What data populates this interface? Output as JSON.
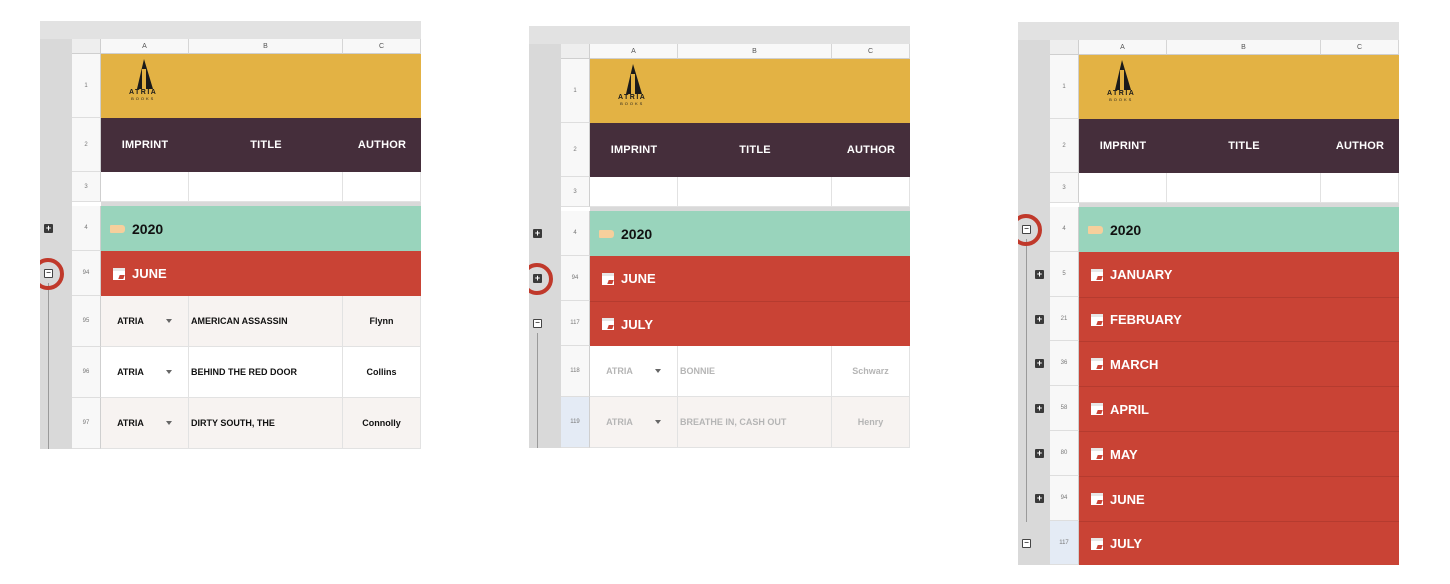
{
  "columns": [
    "A",
    "B",
    "C"
  ],
  "logo": {
    "word": "ATRIA",
    "sub": "BOOKS"
  },
  "header": {
    "imprint": "IMPRINT",
    "title": "TITLE",
    "author": "AUTHOR"
  },
  "year": "2020",
  "group_controls": {
    "expand": "+",
    "collapse": "−"
  },
  "panel1": {
    "row_numbers": [
      "1",
      "2",
      "3",
      "4",
      "94",
      "95",
      "96",
      "97"
    ],
    "month": "JUNE",
    "books": [
      {
        "imprint": "ATRIA",
        "title": "AMERICAN ASSASSIN",
        "author": "Flynn"
      },
      {
        "imprint": "ATRIA",
        "title": "BEHIND THE RED DOOR",
        "author": "Collins"
      },
      {
        "imprint": "ATRIA",
        "title": "DIRTY SOUTH, THE",
        "author": "Connolly"
      }
    ]
  },
  "panel2": {
    "row_numbers": [
      "1",
      "2",
      "3",
      "4",
      "94",
      "117",
      "118",
      "119"
    ],
    "months": [
      "JUNE",
      "JULY"
    ],
    "books": [
      {
        "imprint": "ATRIA",
        "title": "BONNIE",
        "author": "Schwarz"
      },
      {
        "imprint": "ATRIA",
        "title": "BREATHE IN, CASH OUT",
        "author": "Henry"
      }
    ]
  },
  "panel3": {
    "row_numbers": [
      "1",
      "2",
      "3",
      "4"
    ],
    "months": [
      {
        "row": "5",
        "label": "JANUARY"
      },
      {
        "row": "21",
        "label": "FEBRUARY"
      },
      {
        "row": "36",
        "label": "MARCH"
      },
      {
        "row": "58",
        "label": "APRIL"
      },
      {
        "row": "80",
        "label": "MAY"
      },
      {
        "row": "94",
        "label": "JUNE"
      },
      {
        "row": "117",
        "label": "JULY"
      }
    ]
  }
}
